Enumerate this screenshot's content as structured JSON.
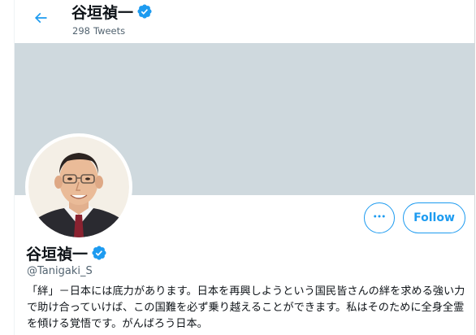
{
  "header": {
    "name": "谷垣禎一",
    "tweet_count": "298",
    "tweet_label": "Tweets",
    "back_icon": "arrow-left-icon",
    "verified_icon": "verified-badge-icon"
  },
  "profile": {
    "name": "谷垣禎一",
    "handle": "@Tanigaki_S",
    "bio": "「絆」－日本には底力があります。日本を再興しようという国民皆さんの絆を求める強い力で助け合っていけば、この国難を必ず乗り越えることができます。私はそのために全身全霊を傾ける覚悟です。がんばろう日本。",
    "verified_icon": "verified-badge-icon"
  },
  "actions": {
    "more_icon": "more-dots-icon",
    "follow_label": "Follow"
  },
  "colors": {
    "accent": "#1d9bf0",
    "banner": "#cfd9de",
    "text_primary": "#0f1419",
    "text_secondary": "#536471"
  }
}
